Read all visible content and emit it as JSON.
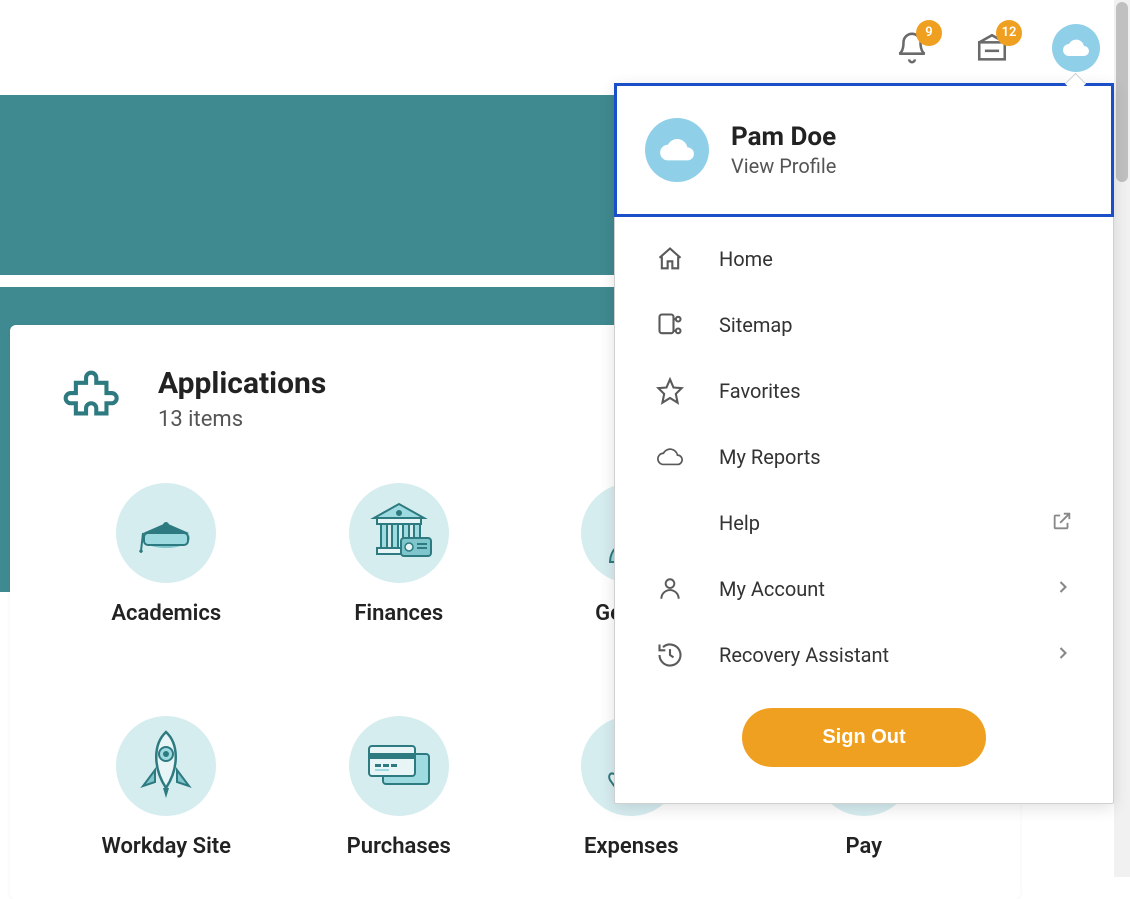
{
  "topbar": {
    "bell_badge": "9",
    "inbox_badge": "12"
  },
  "profile": {
    "name": "Pam Doe",
    "view_label": "View Profile"
  },
  "menu": {
    "home": "Home",
    "sitemap": "Sitemap",
    "favorites": "Favorites",
    "my_reports": "My Reports",
    "help": "Help",
    "my_account": "My Account",
    "recovery_assistant": "Recovery Assistant",
    "sign_out": "Sign Out"
  },
  "apps": {
    "title": "Applications",
    "count_label": "13 items",
    "items": [
      {
        "label": "Academics"
      },
      {
        "label": "Finances"
      },
      {
        "label": "Getting"
      },
      {
        "label": ""
      },
      {
        "label": "Workday Site"
      },
      {
        "label": "Purchases"
      },
      {
        "label": "Expenses"
      },
      {
        "label": "Pay"
      }
    ]
  }
}
